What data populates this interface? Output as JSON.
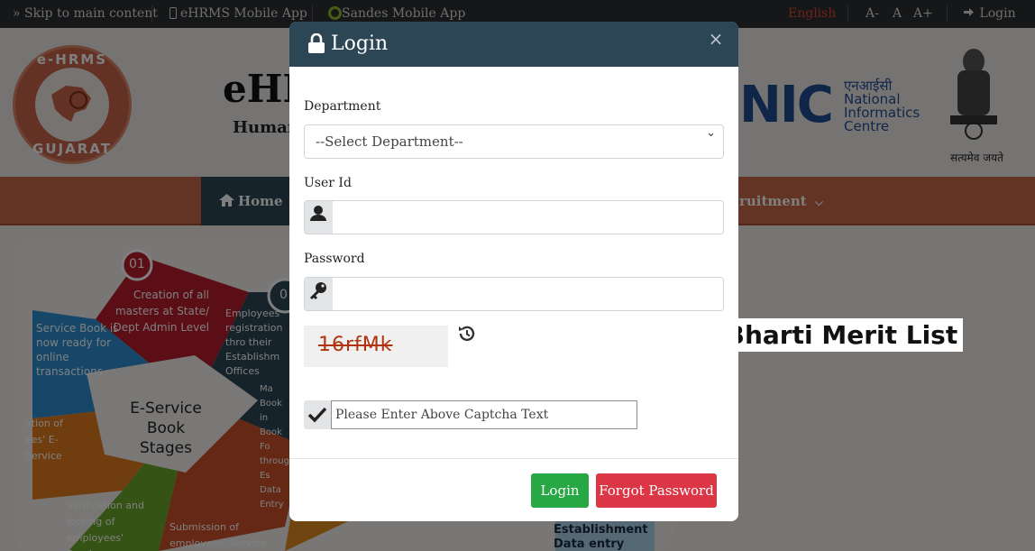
{
  "topbar": {
    "skip_link": "Skip to main content",
    "mobile_app": "eHRMS Mobile App",
    "sandes_app": "Sandes Mobile App",
    "language": "English",
    "font_decrease": "A-",
    "font_normal": "A",
    "font_increase": "A+",
    "login": "Login"
  },
  "header": {
    "logo_top": "e-HRMS",
    "logo_bottom": "GUJARAT",
    "title": "eHI",
    "subtitle": "Human",
    "nic_short": "NIC",
    "nic_hindi": "एनआईसी",
    "nic_line1": "National",
    "nic_line2": "Informatics",
    "nic_line3": "Centre",
    "emblem_caption": "सत्यमेव जयते"
  },
  "nav": {
    "home": "Home",
    "recruitment": "ruitment"
  },
  "infographic": {
    "step_number_1": "01",
    "step_number_2": "0",
    "step1": "Creation of all masters at State/ Dept Admin Level",
    "step2": "Employees registration thro their Establishm Offices",
    "service_book": "Service Book is now ready for online transactions",
    "center_title": "E-Service Book Stages",
    "left_partial": "ation of ees' E-Service",
    "verification": "Verification and locking of employees' Service",
    "submission": "Submission of employees' Service Book forms to",
    "right_partial": "Ma Book in Book Fo through Es Data Entry",
    "bottom_right": "Establishment Data entry"
  },
  "banner": "Anganwadi Bharti Merit List",
  "modal": {
    "title": "Login",
    "close": "×",
    "department_label": "Department",
    "department_selected": "--Select Department--",
    "userid_label": "User Id",
    "userid_value": "",
    "password_label": "Password",
    "password_value": "",
    "captcha": "16rfMk",
    "captcha_placeholder": "Please Enter Above Captcha Text",
    "login_button": "Login",
    "forgot_button": "Forgot Password"
  },
  "colors": {
    "header_bar": "#2c4655",
    "nav_bar": "#c76949",
    "login_green": "#28a745",
    "forgot_red": "#dc3545",
    "captcha_red": "#b1340f"
  }
}
